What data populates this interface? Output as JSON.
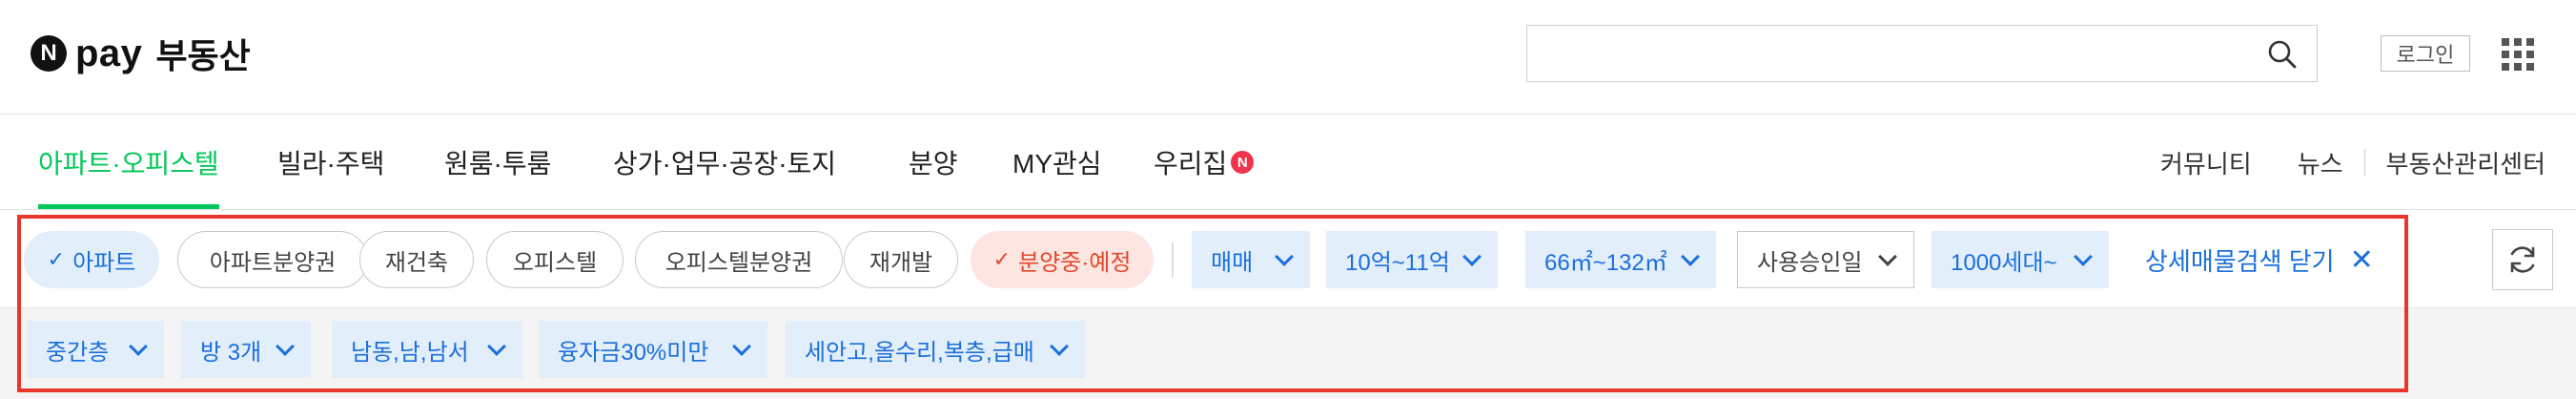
{
  "header": {
    "logo_badge": "N",
    "logo_pay": "pay",
    "logo_title": "부동산",
    "search_placeholder": "",
    "login_label": "로그인",
    "icons": {
      "search": "search-icon",
      "apps": "apps-grid-icon"
    }
  },
  "nav": {
    "tabs": [
      {
        "label": "아파트·오피스텔",
        "active": true
      },
      {
        "label": "빌라·주택",
        "active": false
      },
      {
        "label": "원룸·투룸",
        "active": false
      },
      {
        "label": "상가·업무·공장·토지",
        "active": false
      },
      {
        "label": "분양",
        "active": false
      },
      {
        "label": "MY관심",
        "active": false
      },
      {
        "label": "우리집",
        "active": false,
        "badge": "N"
      }
    ],
    "right": [
      "커뮤니티",
      "뉴스",
      "부동산관리센터"
    ]
  },
  "filters": {
    "types": [
      {
        "label": "아파트",
        "state": "selected"
      },
      {
        "label": "아파트분양권",
        "state": "off"
      },
      {
        "label": "재건축",
        "state": "off"
      },
      {
        "label": "오피스텔",
        "state": "off"
      },
      {
        "label": "오피스텔분양권",
        "state": "off"
      },
      {
        "label": "재개발",
        "state": "off"
      },
      {
        "label": "분양중·예정",
        "state": "selected-red"
      }
    ],
    "dropdowns_row1": [
      "매매",
      "10억~11억",
      "66㎡~132㎡",
      "사용승인일",
      "1000세대~"
    ],
    "close_detail_label": "상세매물검색 닫기",
    "dropdowns_row2": [
      "중간층",
      "방 3개",
      "남동,남,남서",
      "융자금30%미만",
      "세안고,올수리,복층,급매"
    ]
  },
  "colors": {
    "accent_green": "#03c75a",
    "accent_blue": "#1a6fdb",
    "chip_blue_bg": "#e3eefb",
    "chip_red_bg": "#fde6e2",
    "accent_red": "#e2482d",
    "highlight_border": "#e8362a"
  }
}
